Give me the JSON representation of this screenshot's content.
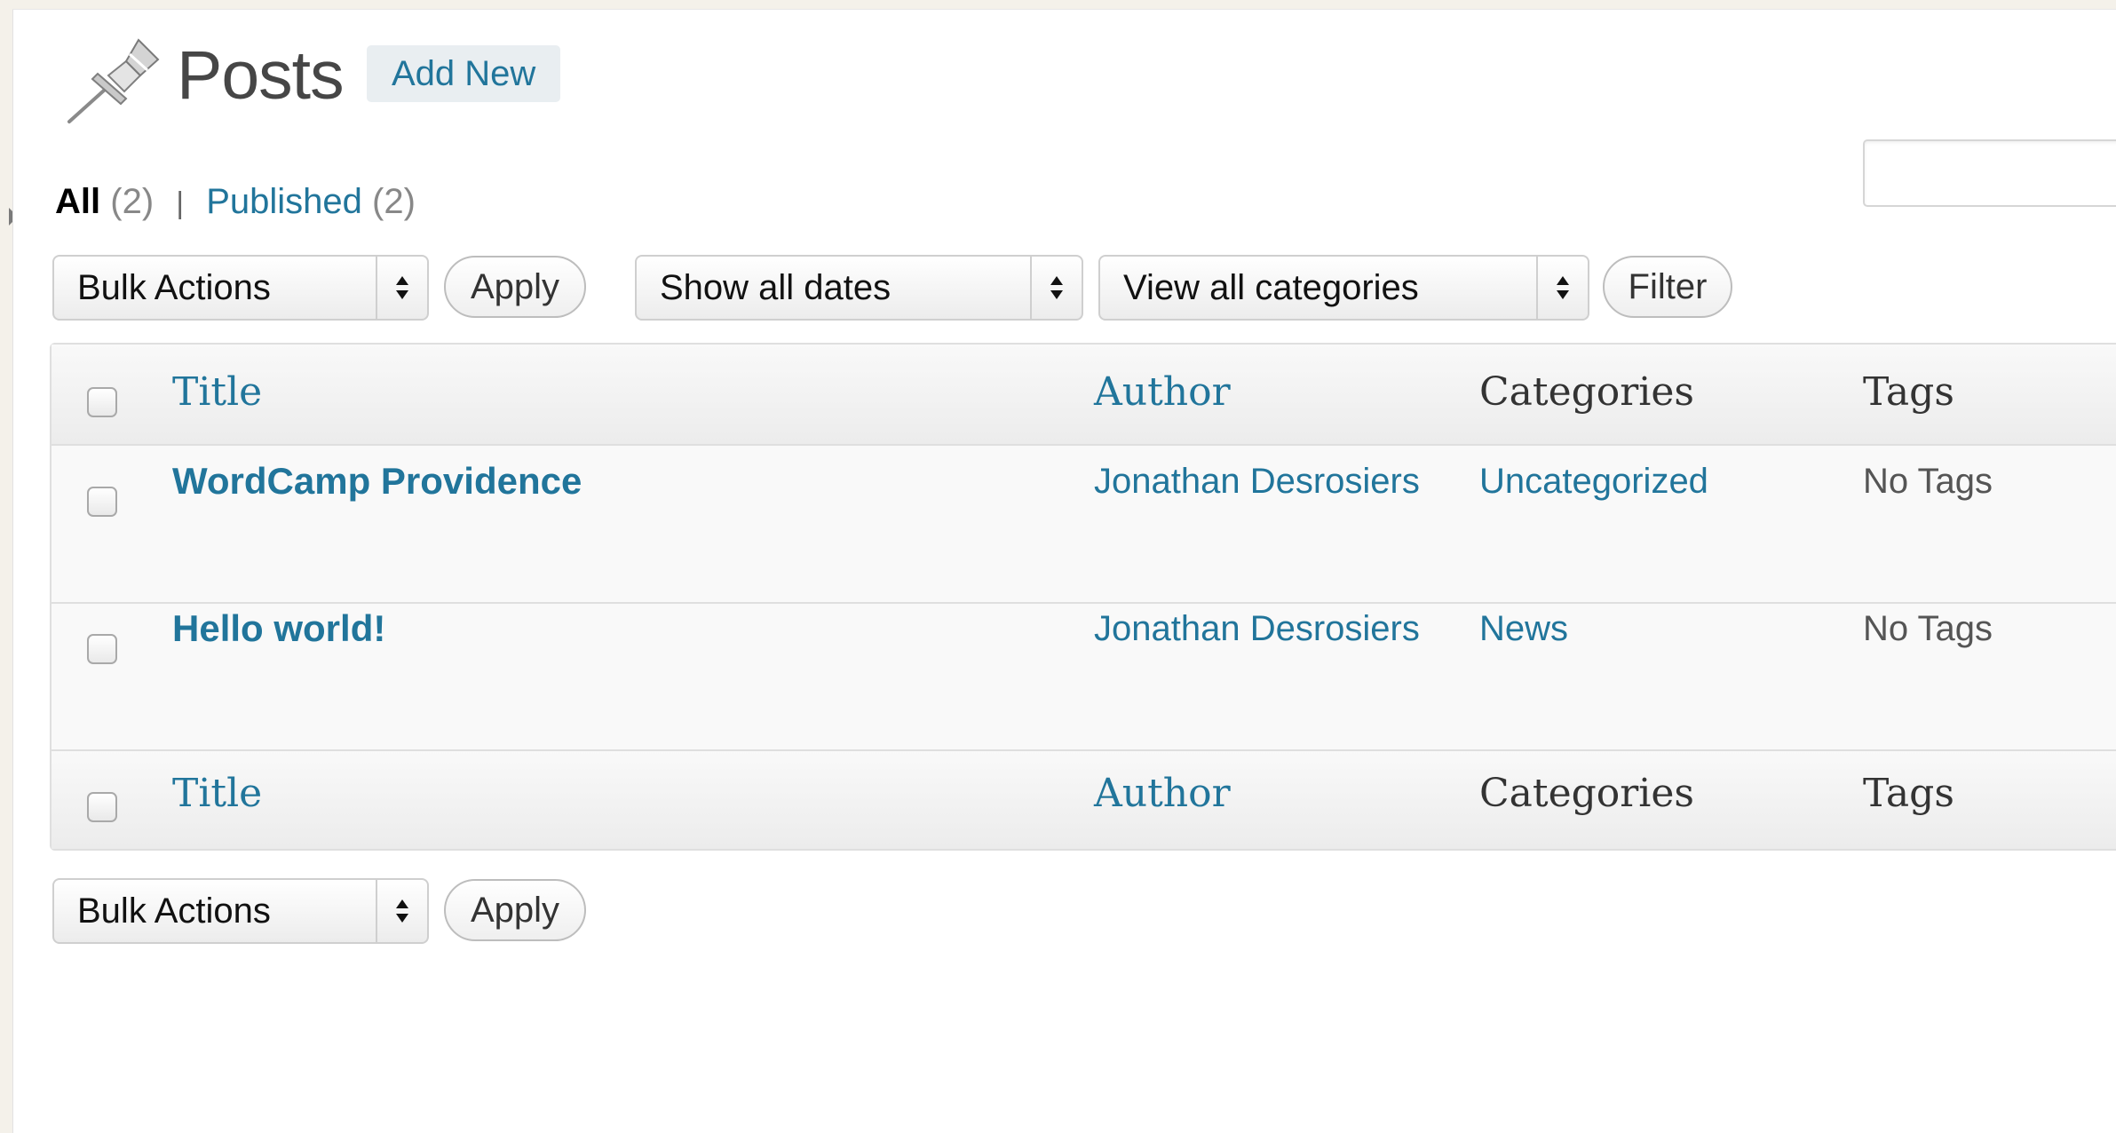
{
  "header": {
    "title": "Posts",
    "add_new_label": "Add New"
  },
  "views": {
    "all_label": "All",
    "all_count": "(2)",
    "separator": "|",
    "published_label": "Published",
    "published_count": "(2)"
  },
  "search": {
    "value": ""
  },
  "top_controls": {
    "bulk_actions": "Bulk Actions",
    "apply_label": "Apply",
    "dates": "Show all dates",
    "categories": "View all categories",
    "filter_label": "Filter"
  },
  "table": {
    "columns": {
      "title": "Title",
      "author": "Author",
      "categories": "Categories",
      "tags": "Tags"
    },
    "rows": [
      {
        "title": "WordCamp Providence",
        "author": "Jonathan Desrosiers",
        "category": "Uncategorized",
        "tags": "No Tags"
      },
      {
        "title": "Hello world!",
        "author": "Jonathan Desrosiers",
        "category": "News",
        "tags": "No Tags"
      }
    ]
  },
  "bottom_controls": {
    "bulk_actions": "Bulk Actions",
    "apply_label": "Apply"
  },
  "colors": {
    "link": "#21759b",
    "background": "#ffffff",
    "outer_background": "#f4f1ea"
  }
}
